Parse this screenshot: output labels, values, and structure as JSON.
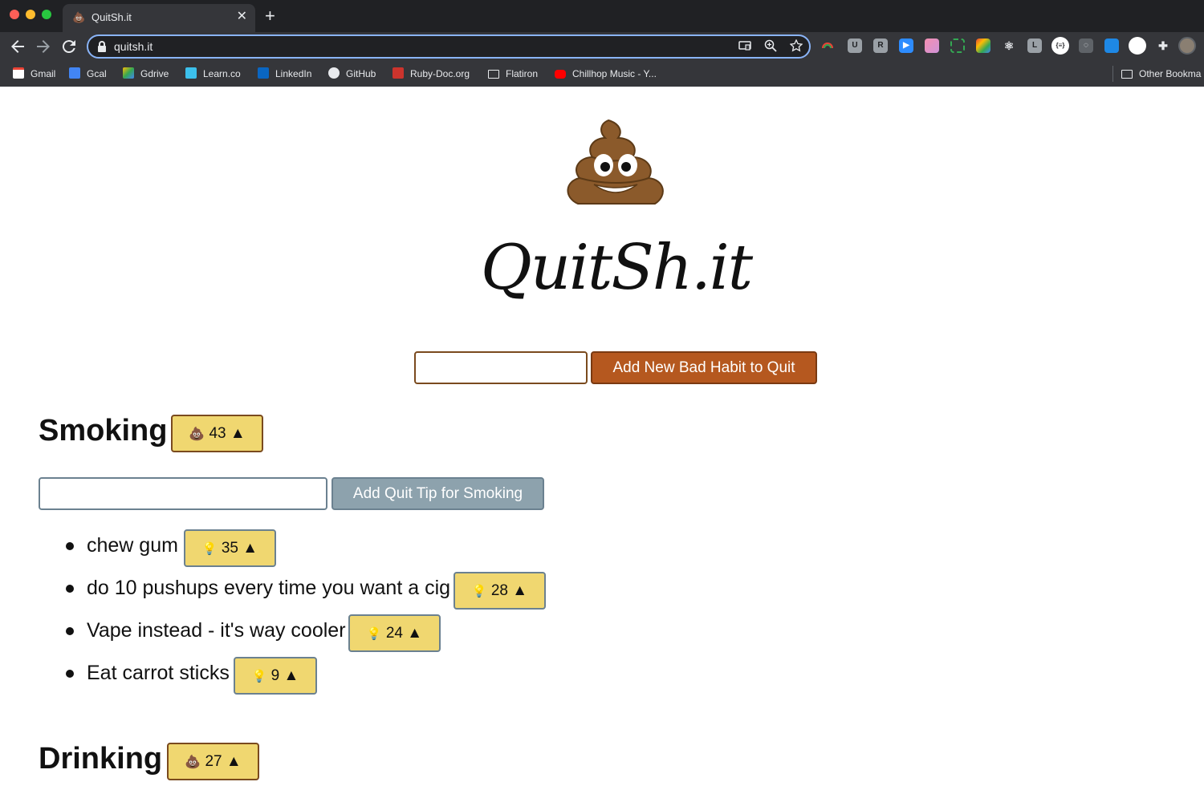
{
  "browser": {
    "tab_title": "QuitSh.it",
    "tab_favicon": "💩",
    "close_glyph": "✕",
    "new_tab_glyph": "+",
    "url": "quitsh.it",
    "bookmarks": [
      "Gmail",
      "Gcal",
      "Gdrive",
      "Learn.co",
      "LinkedIn",
      "GitHub",
      "Ruby-Doc.org",
      "Flatiron",
      "Chillhop Music - Y..."
    ],
    "other_bookmarks": "Other Bookma"
  },
  "header": {
    "logo_emoji": "💩",
    "site_title": "QuitSh.it"
  },
  "new_habit": {
    "input_value": "",
    "button_label": "Add New Bad Habit to Quit"
  },
  "habits": [
    {
      "name": "Smoking",
      "icon": "💩",
      "votes": "43",
      "arrow": "▲",
      "tip_input_value": "",
      "tip_button_label": "Add Quit Tip for Smoking",
      "tips": [
        {
          "text": "chew gum",
          "icon": "💡",
          "votes": "35",
          "arrow": "▲"
        },
        {
          "text": "do 10 pushups every time you want a cig",
          "icon": "💡",
          "votes": "28",
          "arrow": "▲"
        },
        {
          "text": "Vape instead - it's way cooler",
          "icon": "💡",
          "votes": "24",
          "arrow": "▲"
        },
        {
          "text": "Eat carrot sticks",
          "icon": "💡",
          "votes": "9",
          "arrow": "▲"
        }
      ]
    },
    {
      "name": "Drinking",
      "icon": "💩",
      "votes": "27",
      "arrow": "▲"
    }
  ],
  "colors": {
    "primary_button": "#b5581f",
    "vote_badge": "#f0d770",
    "secondary_button": "#8da2ad"
  }
}
